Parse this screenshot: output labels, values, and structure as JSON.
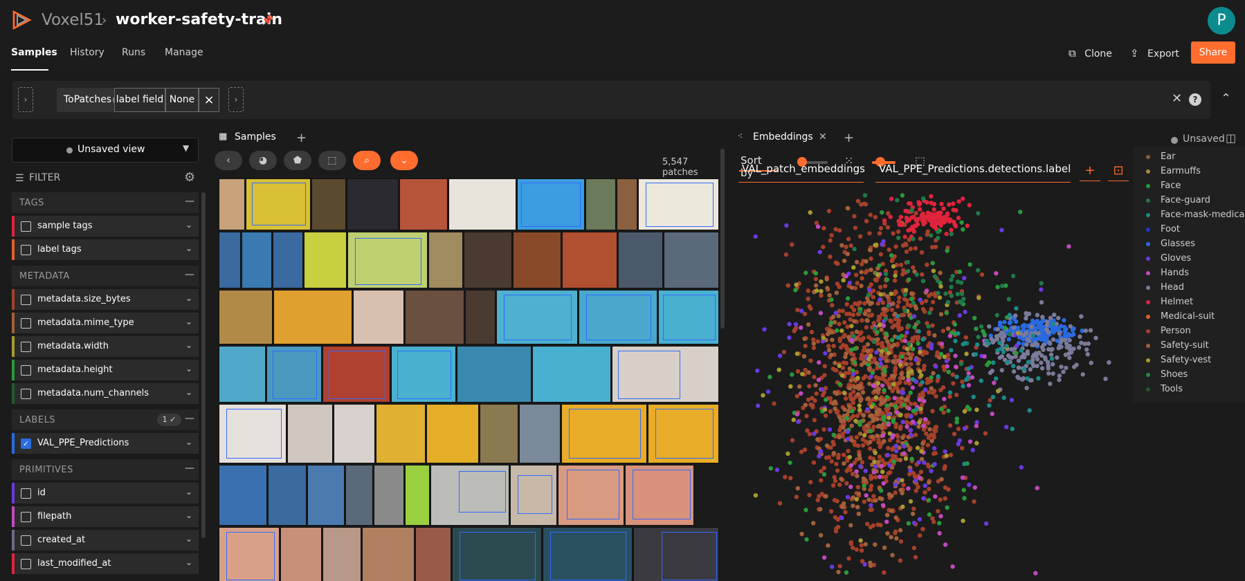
{
  "header": {
    "brand": "Voxel51",
    "separator": "›",
    "dataset": "worker-safety-train",
    "avatar_initial": "P"
  },
  "nav": {
    "tabs": [
      {
        "label": "Samples",
        "active": true
      },
      {
        "label": "History"
      },
      {
        "label": "Runs"
      },
      {
        "label": "Manage"
      }
    ],
    "actions": {
      "clone": "Clone",
      "export": "Export",
      "share": "Share"
    }
  },
  "view_bar": {
    "stage": "ToPatches",
    "param_name": "label field",
    "param_value": "None",
    "remove": "×"
  },
  "sidebar": {
    "view": "Unsaved view",
    "filter": "FILTER",
    "sections": {
      "tags": "TAGS",
      "metadata": "METADATA",
      "labels": "LABELS",
      "labels_count": "1 ✓",
      "primitives": "PRIMITIVES"
    },
    "tag_fields": [
      "sample tags",
      "label tags"
    ],
    "metadata_fields": [
      "metadata.size_bytes",
      "metadata.mime_type",
      "metadata.width",
      "metadata.height",
      "metadata.num_channels"
    ],
    "label_fields": [
      "VAL_PPE_Predictions"
    ],
    "primitive_fields": [
      "id",
      "filepath",
      "created_at",
      "last_modified_at"
    ],
    "stripe_colors": {
      "sample_tags": "#e0243c",
      "label_tags": "#e0602a",
      "size_bytes": "#a6402a",
      "mime_type": "#a4603a",
      "width": "#a89a2e",
      "height": "#2a9a3a",
      "num_channels": "#1f5a2a",
      "predictions": "#2a6ae0",
      "id": "#6a3ae0",
      "filepath": "#c04ac0",
      "created_at": "#6a6a8a",
      "last_modified_at": "#e0243c"
    }
  },
  "samples_panel": {
    "tab": "Samples",
    "patch_count": "5,547 patches",
    "sort_by": "Sort by"
  },
  "embeddings_panel": {
    "tab": "Embeddings",
    "status": "Unsaved",
    "brain_key": "VAL_patch_embeddings",
    "color_by": "VAL_PPE_Predictions.detections.label",
    "legend": [
      {
        "label": "Ear",
        "color": "#8a5a3a"
      },
      {
        "label": "Earmuffs",
        "color": "#b08a3a"
      },
      {
        "label": "Face",
        "color": "#2a9a3a"
      },
      {
        "label": "Face-guard",
        "color": "#1f7a4a"
      },
      {
        "label": "Face-mask-medical",
        "color": "#1a8a8a"
      },
      {
        "label": "Foot",
        "color": "#1a3ad0"
      },
      {
        "label": "Glasses",
        "color": "#2a6ae0"
      },
      {
        "label": "Gloves",
        "color": "#6a3ae0"
      },
      {
        "label": "Hands",
        "color": "#c04ac0"
      },
      {
        "label": "Head",
        "color": "#7a7a9a"
      },
      {
        "label": "Helmet",
        "color": "#e0243c"
      },
      {
        "label": "Medical-suit",
        "color": "#e0602a"
      },
      {
        "label": "Person",
        "color": "#a6402a"
      },
      {
        "label": "Safety-suit",
        "color": "#a4603a"
      },
      {
        "label": "Safety-vest",
        "color": "#a89a2e"
      },
      {
        "label": "Shoes",
        "color": "#2a8a3a"
      },
      {
        "label": "Tools",
        "color": "#1f5a2a"
      }
    ]
  },
  "colors": {
    "accent": "#ff6d2e",
    "avatar": "#0c8b8f",
    "check": "#2b6cde"
  }
}
